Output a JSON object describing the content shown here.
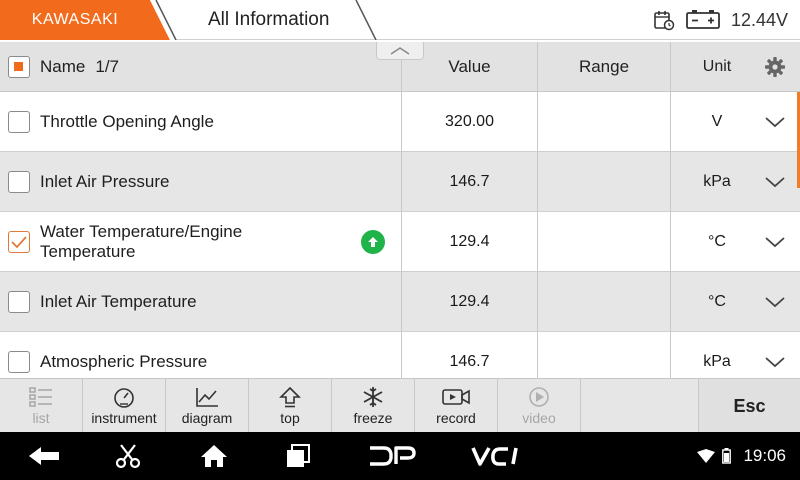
{
  "header": {
    "brand": "KAWASAKI",
    "title": "All Information",
    "voltage": "12.44V",
    "brand_color": "#f26b1d"
  },
  "table": {
    "columns": {
      "name": "Name",
      "page": "1/7",
      "value": "Value",
      "range": "Range",
      "unit": "Unit"
    },
    "rows": [
      {
        "name": "Throttle Opening Angle",
        "value": "320.00",
        "range": "",
        "unit": "V",
        "checked": false
      },
      {
        "name": "Inlet Air Pressure",
        "value": "146.7",
        "range": "",
        "unit": "kPa",
        "checked": false
      },
      {
        "name": "Water Temperature/Engine Temperature",
        "value": "129.4",
        "range": "",
        "unit": "°C",
        "checked": true,
        "indicator": "green-status-icon"
      },
      {
        "name": "Inlet Air Temperature",
        "value": "129.4",
        "range": "",
        "unit": "°C",
        "checked": false
      },
      {
        "name": "Atmospheric Pressure",
        "value": "146.7",
        "range": "",
        "unit": "kPa",
        "checked": false
      }
    ]
  },
  "toolbar": {
    "list": "list",
    "instrument": "instrument",
    "diagram": "diagram",
    "top": "top",
    "freeze": "freeze",
    "record": "record",
    "video": "video",
    "esc": "Esc"
  },
  "navbar": {
    "time": "19:06"
  }
}
